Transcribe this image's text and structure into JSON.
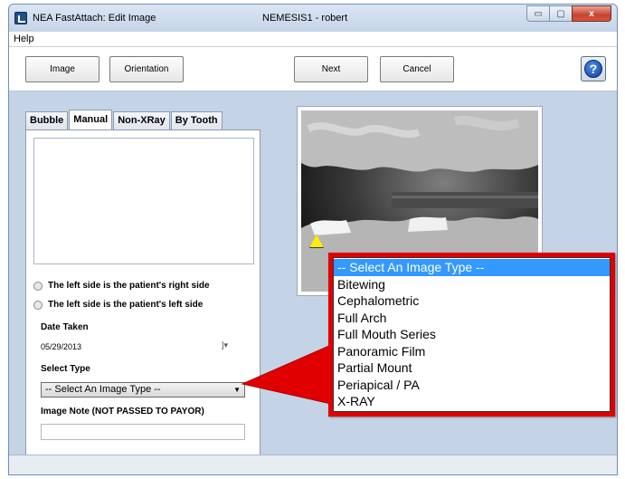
{
  "window": {
    "title": "NEA FastAttach: Edit Image",
    "host_user": "NEMESIS1 - robert",
    "min_glyph": "▭",
    "max_glyph": "▢",
    "close_glyph": "x"
  },
  "menu": {
    "help": "Help"
  },
  "toolbar": {
    "image": "Image",
    "orientation": "Orientation",
    "next": "Next",
    "cancel": "Cancel",
    "help_glyph": "?"
  },
  "tabs": [
    "Bubble",
    "Manual",
    "Non-XRay",
    "By Tooth"
  ],
  "form": {
    "radio_right": "The left side is the patient's right side",
    "radio_left": "The left side is the patient's left side",
    "date_label": "Date Taken",
    "date_value": "05/29/2013",
    "date_dropdown_glyph": "]▾",
    "type_label": "Select Type",
    "type_value": "-- Select An Image Type --",
    "type_arrow": "▼",
    "note_label": "Image Note (NOT PASSED TO PAYOR)",
    "note_value": ""
  },
  "callout": {
    "options": [
      "-- Select An Image Type --",
      "Bitewing",
      "Cephalometric",
      "Full Arch",
      "Full Mouth Series",
      "Panoramic Film",
      "Partial Mount",
      "Periapical / PA",
      "X-RAY"
    ],
    "selected_index": 0,
    "highlight_color": "#e00000",
    "selection_color": "#3399ff"
  }
}
